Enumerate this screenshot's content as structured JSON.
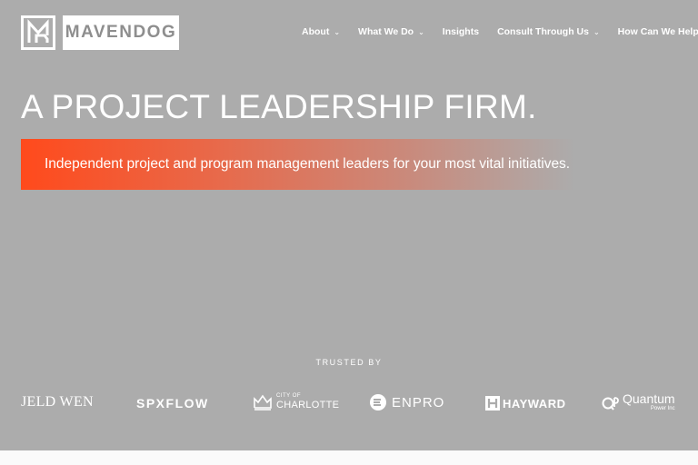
{
  "brand": {
    "name": "MAVENDOG"
  },
  "nav": [
    {
      "label": "About",
      "dropdown": true
    },
    {
      "label": "What We Do",
      "dropdown": true
    },
    {
      "label": "Insights",
      "dropdown": false
    },
    {
      "label": "Consult Through Us",
      "dropdown": true
    },
    {
      "label": "How Can We Help?",
      "dropdown": true
    }
  ],
  "hero": {
    "headline": "A PROJECT LEADERSHIP FIRM.",
    "tagline": "Independent project and program management leaders for your most vital initiatives."
  },
  "trusted": {
    "label": "TRUSTED BY",
    "clients": [
      {
        "name": "JELD-WEN",
        "text": "JELD WEN"
      },
      {
        "name": "SPXFLOW",
        "text": "SPXFLOW"
      },
      {
        "name": "City of Charlotte",
        "small": "CITY OF",
        "big": "CHARLOTTE"
      },
      {
        "name": "EnPro",
        "text": "ENPRO"
      },
      {
        "name": "Hayward",
        "text": "HAYWARD"
      },
      {
        "name": "Quantum Power Inc",
        "big": "Quantum",
        "small": "Power Inc"
      }
    ]
  },
  "colors": {
    "background": "#acacac",
    "accent": "#ff4a1c",
    "text": "#ffffff"
  },
  "icons": {
    "chevron": "chevron-down-icon"
  }
}
